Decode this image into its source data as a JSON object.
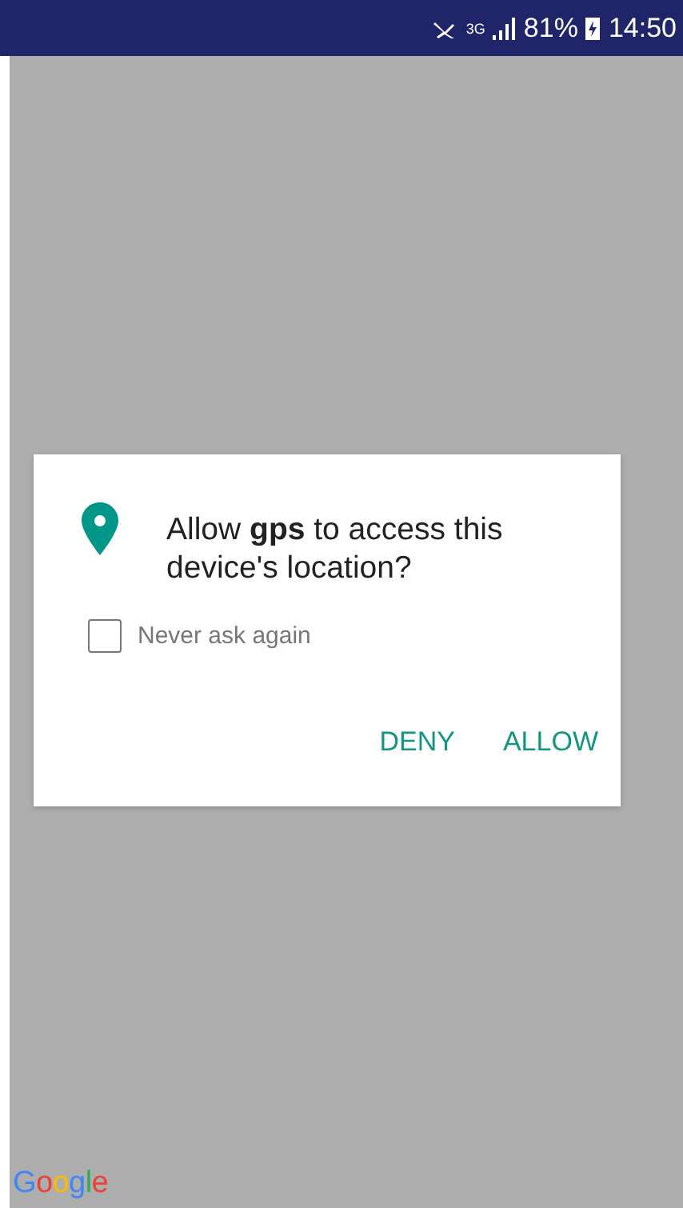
{
  "status_bar": {
    "network": "3G",
    "battery": "81%",
    "time": "14:50"
  },
  "dialog": {
    "message": "Allow **gps** to access this device's location?",
    "checkbox": {
      "label": "Never ask again",
      "checked": false
    },
    "buttons": [
      "DENY",
      "ALLOW"
    ]
  },
  "logo": {
    "text": "Google"
  }
}
